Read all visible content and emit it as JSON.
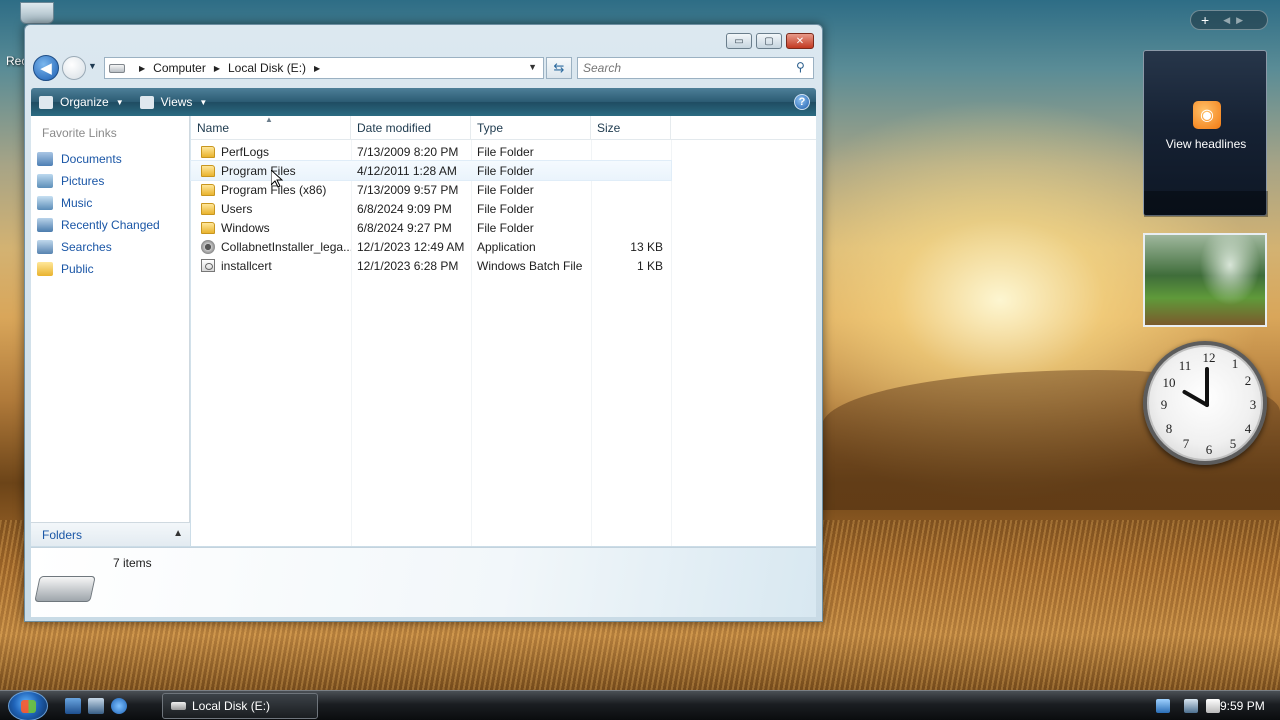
{
  "desktop": {
    "recycle_bin_label": "Rec"
  },
  "window": {
    "caption_buttons": {
      "minimize": "▭",
      "maximize": "▢",
      "close": "✕"
    },
    "breadcrumb": [
      "Computer",
      "Local Disk (E:)"
    ],
    "search_placeholder": "Search",
    "toolbar": {
      "organize": "Organize",
      "views": "Views",
      "help": "?"
    },
    "nav_pane": {
      "title": "Favorite Links",
      "links": [
        "Documents",
        "Pictures",
        "Music",
        "Recently Changed",
        "Searches",
        "Public"
      ],
      "folders_label": "Folders"
    },
    "columns": [
      "Name",
      "Date modified",
      "Type",
      "Size"
    ],
    "files": [
      {
        "name": "PerfLogs",
        "date": "7/13/2009 8:20 PM",
        "type": "File Folder",
        "size": "",
        "icon": "folder-icon"
      },
      {
        "name": "Program Files",
        "date": "4/12/2011 1:28 AM",
        "type": "File Folder",
        "size": "",
        "icon": "folder-icon"
      },
      {
        "name": "Program Files (x86)",
        "date": "7/13/2009 9:57 PM",
        "type": "File Folder",
        "size": "",
        "icon": "folder-icon"
      },
      {
        "name": "Users",
        "date": "6/8/2024 9:09 PM",
        "type": "File Folder",
        "size": "",
        "icon": "folder-icon"
      },
      {
        "name": "Windows",
        "date": "6/8/2024 9:27 PM",
        "type": "File Folder",
        "size": "",
        "icon": "folder-icon"
      },
      {
        "name": "CollabnetInstaller_lega...",
        "date": "12/1/2023 12:49 AM",
        "type": "Application",
        "size": "13 KB",
        "icon": "application-icon"
      },
      {
        "name": "installcert",
        "date": "12/1/2023 6:28 PM",
        "type": "Windows Batch File",
        "size": "1 KB",
        "icon": "batch-file-icon"
      }
    ],
    "details": {
      "item_count": "7 items"
    }
  },
  "gadgets": {
    "feed_label": "View headlines",
    "clock_numbers": [
      "12",
      "1",
      "2",
      "3",
      "4",
      "5",
      "6",
      "7",
      "8",
      "9",
      "10",
      "11"
    ]
  },
  "taskbar": {
    "active_window": "Local Disk (E:)",
    "time": "9:59 PM"
  },
  "colors": {
    "link": "#1a56a6",
    "toolbar": "#2b5b73",
    "close_button": "#c23a22"
  }
}
